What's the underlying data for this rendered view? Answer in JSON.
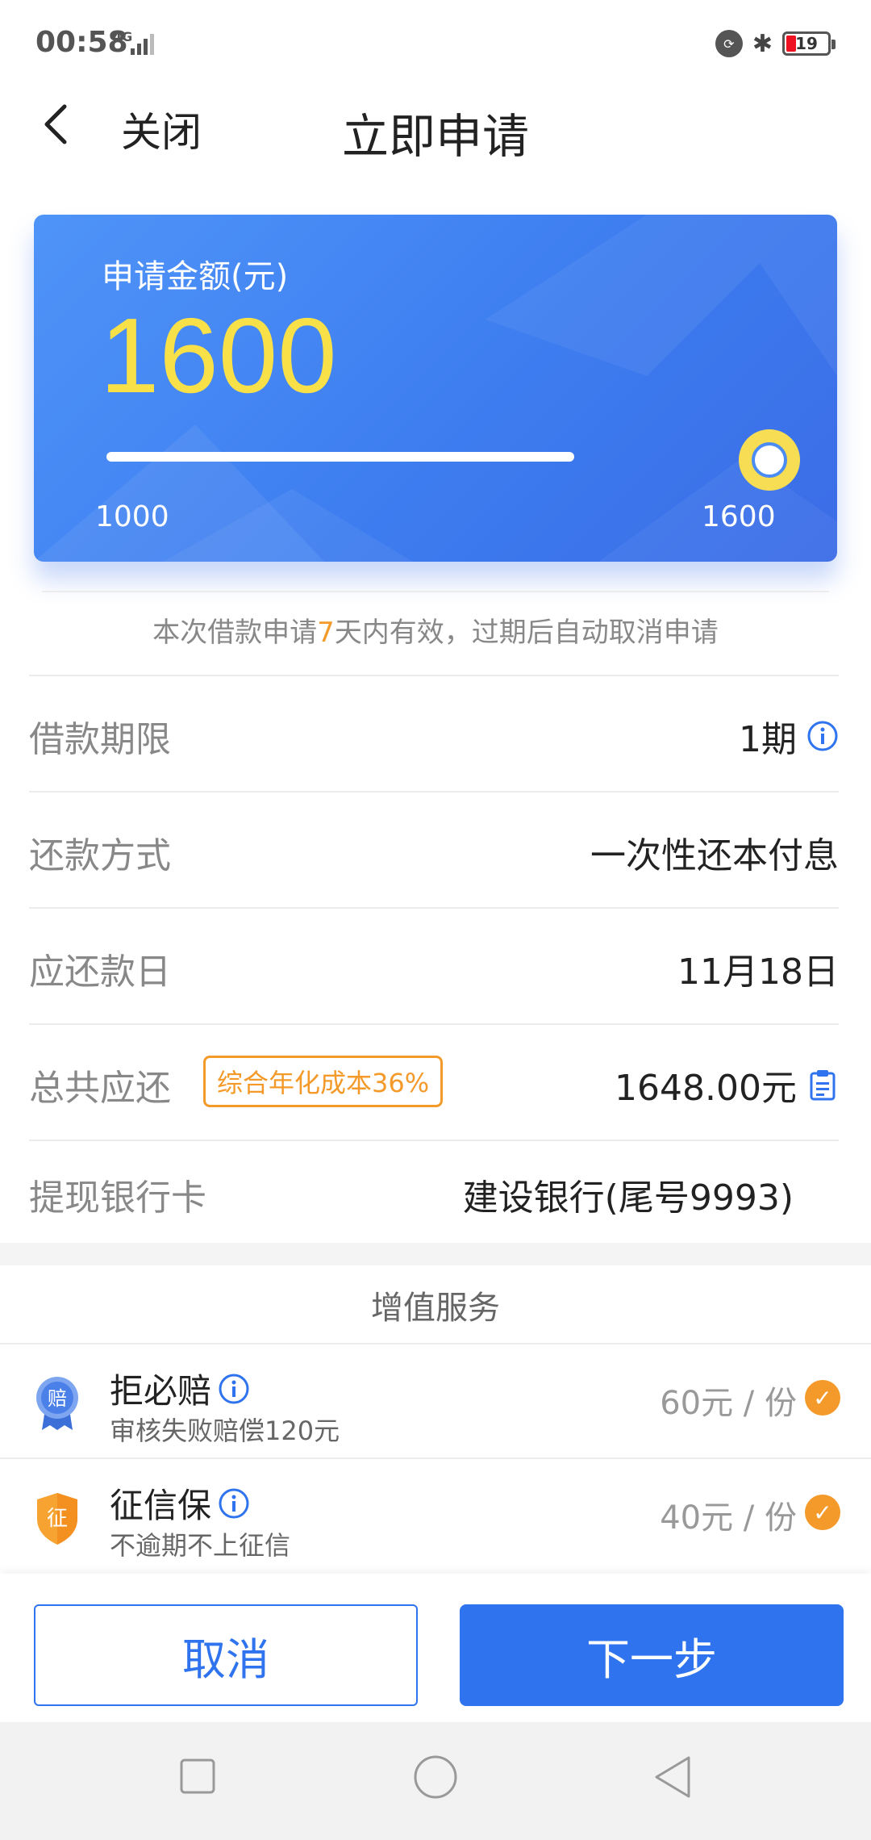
{
  "status": {
    "time": "00:58",
    "network": "4G",
    "battery": "19"
  },
  "nav": {
    "close_label": "关闭",
    "title": "立即申请"
  },
  "hero": {
    "label": "申请金额(元)",
    "amount": "1600",
    "slider_min": "1000",
    "slider_max": "1600",
    "slider_fraction": 1.0
  },
  "notice": {
    "prefix": "本次借款申请",
    "days": "7",
    "suffix": "天内有效，过期后自动取消申请"
  },
  "rows": [
    {
      "label": "借款期限",
      "value": "1期"
    },
    {
      "label": "还款方式",
      "value": "一次性还本付息"
    },
    {
      "label": "应还款日",
      "value": "11月18日"
    },
    {
      "label": "总共应还",
      "tag": "综合年化成本36%",
      "value": "1648.00元"
    },
    {
      "label": "提现银行卡",
      "value": "建设银行(尾号9993)"
    }
  ],
  "vas": {
    "title": "增值服务",
    "items": [
      {
        "name": "拒必赔",
        "desc": "审核失败赔偿120元",
        "price": "60元 / 份",
        "icon_char": "赔"
      },
      {
        "name": "征信保",
        "desc": "不逾期不上征信",
        "price": "40元 / 份",
        "icon_char": "征"
      }
    ]
  },
  "buttons": {
    "cancel": "取消",
    "next": "下一步"
  },
  "colors": {
    "primary": "#2f74ee",
    "accent_orange": "#f39a2a",
    "amount_yellow": "#f8e048"
  }
}
